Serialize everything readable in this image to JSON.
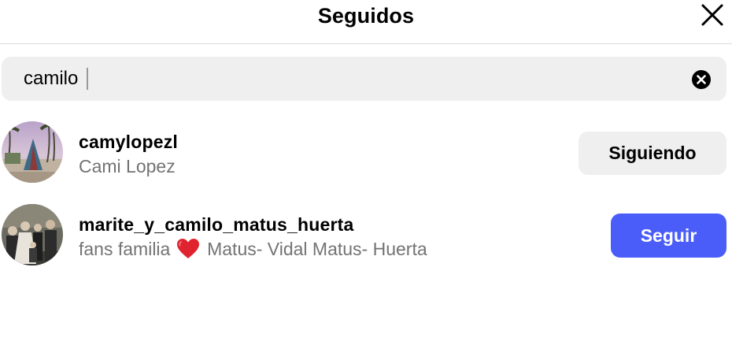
{
  "header": {
    "title": "Seguidos",
    "close_icon": "close-icon"
  },
  "search": {
    "value": "camilo",
    "clear_icon": "clear-circle-icon"
  },
  "results": [
    {
      "username": "camylopezl",
      "full_name": "Cami Lopez",
      "button_label": "Siguiendo",
      "button_state": "following"
    },
    {
      "username": "marite_y_camilo_matus_huerta",
      "full_name_prefix": "fans familia",
      "full_name_icon": "red-heart-emoji",
      "full_name_suffix": "Matus- Vidal Matus- Huerta",
      "button_label": "Seguir",
      "button_state": "follow"
    }
  ],
  "colors": {
    "follow_button": "#4a5df9",
    "following_button": "#efefef",
    "secondary_text": "#737373",
    "search_bg": "#efefef",
    "divider": "#dbdbdb"
  }
}
